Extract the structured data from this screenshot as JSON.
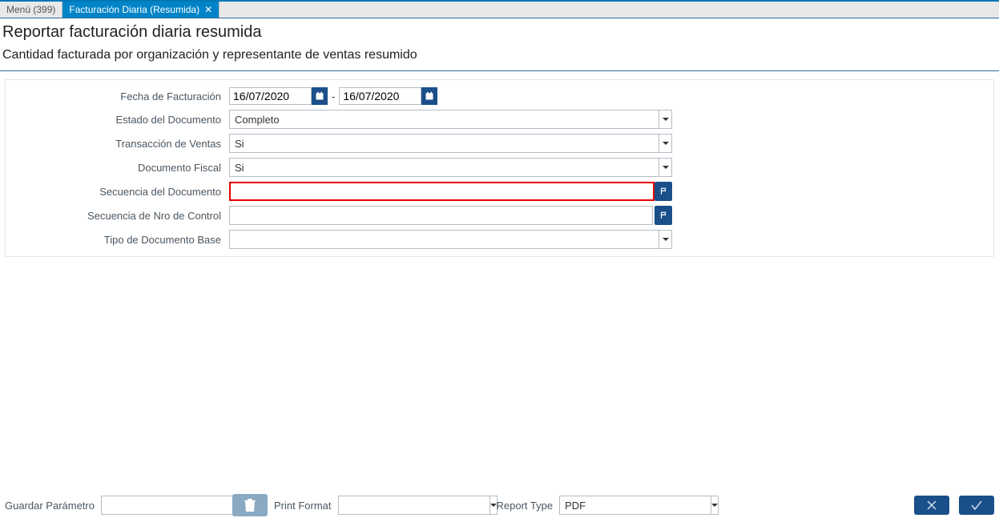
{
  "tabs": {
    "menu": "Menú (399)",
    "active": "Facturación Diaria (Resumida)"
  },
  "header": {
    "title": "Reportar facturación diaria resumida",
    "subtitle": "Cantidad facturada por organización y representante de ventas resumido"
  },
  "form": {
    "labels": {
      "fecha": "Fecha de Facturación",
      "estado": "Estado del Documento",
      "transaccion": "Transacción de Ventas",
      "fiscal": "Documento Fiscal",
      "secuencia_doc": "Secuencia del Documento",
      "secuencia_ctrl": "Secuencia de Nro de Control",
      "tipo_doc": "Tipo de Documento Base"
    },
    "values": {
      "fecha_from": "16/07/2020",
      "fecha_to": "16/07/2020",
      "estado": "Completo",
      "transaccion": "Si",
      "fiscal": "Si",
      "secuencia_doc": "",
      "secuencia_ctrl": "",
      "tipo_doc": ""
    }
  },
  "footer": {
    "guardar_label": "Guardar Parámetro",
    "guardar_value": "",
    "print_label": "Print Format",
    "print_value": "",
    "report_label": "Report Type",
    "report_value": "PDF"
  }
}
